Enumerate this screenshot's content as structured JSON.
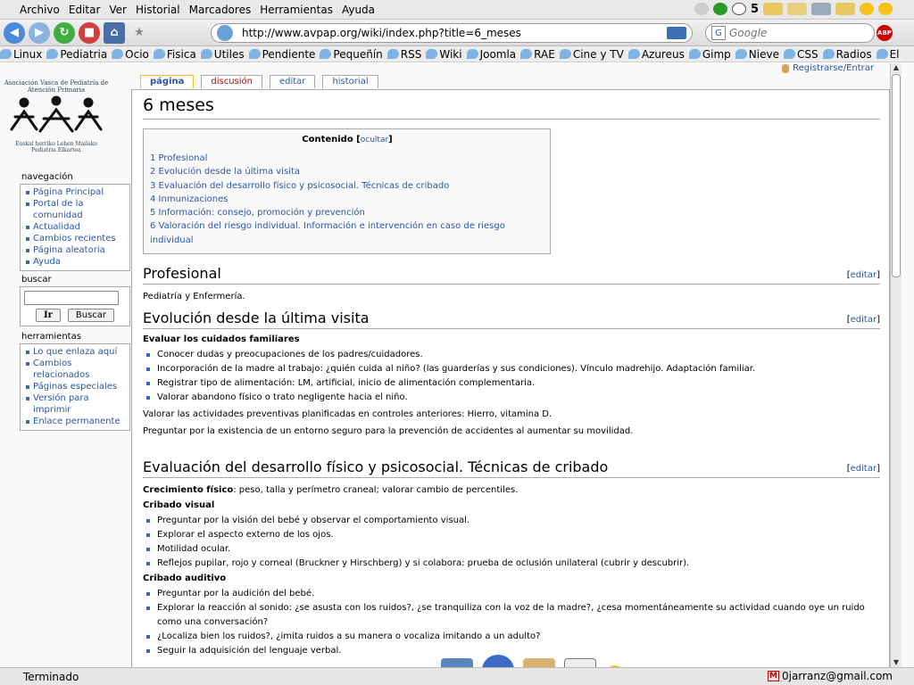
{
  "menubar": {
    "items": [
      "Archivo",
      "Editar",
      "Ver",
      "Historial",
      "Marcadores",
      "Herramientas",
      "Ayuda"
    ]
  },
  "tray": {
    "count": "5"
  },
  "navbar": {
    "url": "http://www.avpap.org/wiki/index.php?title=6_meses",
    "search_placeholder": "Google",
    "adblock_label": "ABP"
  },
  "bookmarks": [
    "Linux",
    "Pediatria",
    "Ocio",
    "Fisica",
    "Utiles",
    "Pendiente",
    "Pequeñín",
    "RSS",
    "Wiki",
    "Joomla",
    "RAE",
    "Cine y TV",
    "Azureus",
    "Gimp",
    "Nieve",
    "CSS",
    "Radios",
    "El"
  ],
  "sidebar": {
    "logo_text_top": "Asociación Vasca de Pediatría de Atención Primaria",
    "logo_text_bottom": "Euskal herriko Lehen Mailako Pediatria Elkartea",
    "nav_title": "navegación",
    "nav_items": [
      "Página Principal",
      "Portal de la comunidad",
      "Actualidad",
      "Cambios recientes",
      "Página aleatoria",
      "Ayuda"
    ],
    "search_title": "buscar",
    "go_button": "Ir",
    "search_button": "Buscar",
    "tools_title": "herramientas",
    "tools_items": [
      "Lo que enlaza aquí",
      "Cambios relacionados",
      "Páginas especiales",
      "Versión para imprimir",
      "Enlace permanente"
    ]
  },
  "tabs": [
    "página",
    "discusión",
    "editar",
    "historial"
  ],
  "user_link": "Registrarse/Entrar",
  "article": {
    "title": "6 meses",
    "toc_title": "Contenido",
    "toc_toggle": "ocultar",
    "toc": [
      "1 Profesional",
      "2 Evolución desde la última visita",
      "3 Evaluación del desarrollo físico y psicosocial. Técnicas de cribado",
      "4 Inmunizaciones",
      "5 Información: consejo, promoción y prevención",
      "6 Valoración del riesgo individual. Información e intervención en caso de riesgo individual"
    ],
    "edit_label": "editar",
    "s1_title": "Profesional",
    "s1_text": "Pediatría y Enfermería.",
    "s2_title": "Evolución desde la última visita",
    "s2_sub": "Evaluar los cuidados familiares",
    "s2_items": [
      "Conocer dudas y preocupaciones de los padres/cuidadores.",
      "Incorporación de la madre al trabajo: ¿quién cuida al niño? (las guarderías y sus condiciones). Vínculo madrehijo. Adaptación familiar.",
      "Registrar tipo de alimentación: LM, artificial, inicio de alimentación complementaria.",
      "Valorar abandono físico o trato negligente hacia el niño."
    ],
    "s2_p1": "Valorar las actividades preventivas planificadas en controles anteriores: Hierro, vitamina D.",
    "s2_p2": "Preguntar por la existencia de un entorno seguro para la prevención de accidentes al aumentar su movilidad.",
    "s3_title": "Evaluación del desarrollo físico y psicosocial. Técnicas de cribado",
    "s3_growth_bold": "Crecimiento físico",
    "s3_growth_text": ": peso, talla y perímetro craneal; valorar cambio de percentiles.",
    "s3_visual_title": "Cribado visual",
    "s3_visual_items": [
      "Preguntar por la visión del bebé y observar el comportamiento visual.",
      "Explorar el aspecto externo de los ojos.",
      "Motilidad ocular.",
      "Reflejos pupilar, rojo y corneal (Bruckner y Hirschberg) y si colabora: prueba de oclusión unilateral (cubrir y descubrir)."
    ],
    "s3_audit_title": "Cribado auditivo",
    "s3_audit_items": [
      "Preguntar por la audición del bebé.",
      "Explorar la reacción al sonido: ¿se asusta con los ruidos?, ¿se tranquiliza con la voz de la madre?, ¿cesa momentáneamente su actividad cuando oye un ruido como una conversación?",
      "¿Localiza bien los ruidos?, ¿imita ruidos a su manera o vocaliza imitando a un adulto?",
      "Seguir la adquisición del lenguaje verbal."
    ]
  },
  "statusbar": {
    "status": "Terminado",
    "mail": "0jarranz@gmail.com",
    "mail_icon": "M"
  },
  "colors": {
    "link": "#2a55a5",
    "new_link": "#ba0000",
    "active_tab_border": "#fabd23"
  }
}
